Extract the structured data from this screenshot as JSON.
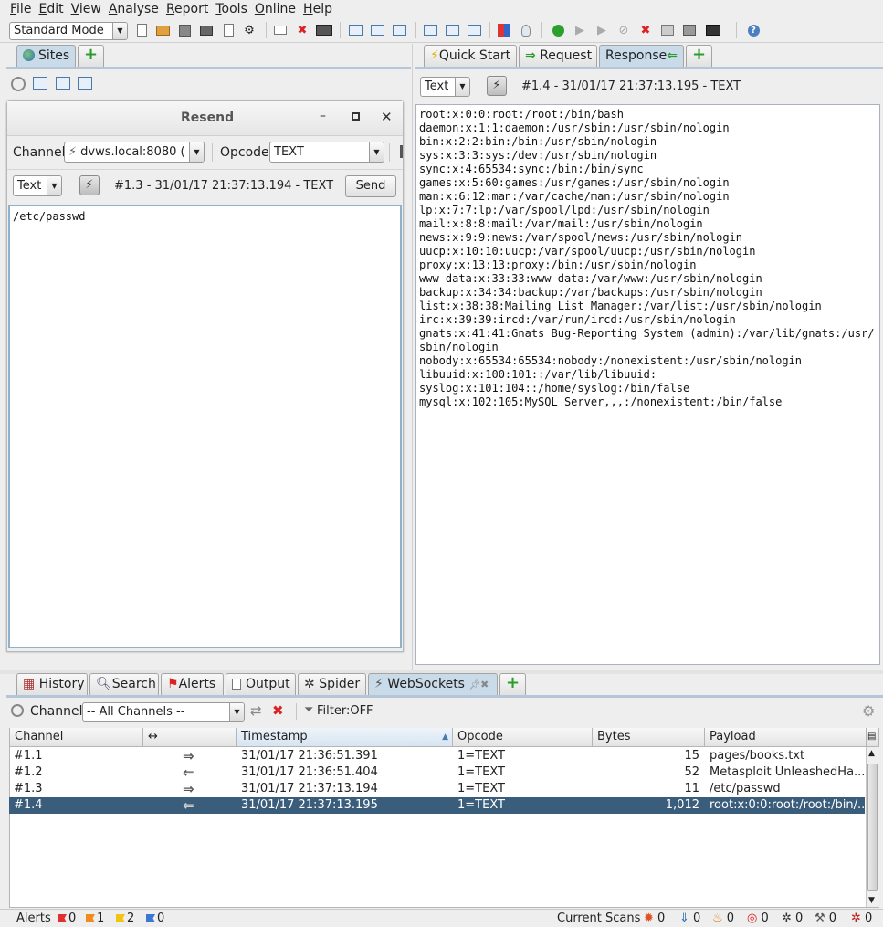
{
  "menu": {
    "items": [
      "File",
      "Edit",
      "View",
      "Analyse",
      "Report",
      "Tools",
      "Online",
      "Help"
    ],
    "underline": [
      "F",
      "E",
      "V",
      "A",
      "R",
      "T",
      "O",
      "H"
    ]
  },
  "toolbar": {
    "mode": "Standard Mode"
  },
  "sites_panel": {
    "tab_label": "Sites"
  },
  "resend": {
    "title": "Resend",
    "channel_label": "Channel:",
    "channel_value": "dvws.local:8080 (",
    "opcode_label": "Opcode:",
    "opcode_value": "TEXT",
    "format_value": "Text",
    "message_info": "#1.3 - 31/01/17 21:37:13.194 - TEXT",
    "send_label": "Send",
    "body": "/etc/passwd"
  },
  "right_tabs": [
    "Quick Start",
    "Request",
    "Response"
  ],
  "response": {
    "format_value": "Text",
    "message_info": "#1.4 - 31/01/17 21:37:13.195 - TEXT",
    "lines": [
      "root:x:0:0:root:/root:/bin/bash",
      "daemon:x:1:1:daemon:/usr/sbin:/usr/sbin/nologin",
      "bin:x:2:2:bin:/bin:/usr/sbin/nologin",
      "sys:x:3:3:sys:/dev:/usr/sbin/nologin",
      "sync:x:4:65534:sync:/bin:/bin/sync",
      "games:x:5:60:games:/usr/games:/usr/sbin/nologin",
      "man:x:6:12:man:/var/cache/man:/usr/sbin/nologin",
      "lp:x:7:7:lp:/var/spool/lpd:/usr/sbin/nologin",
      "mail:x:8:8:mail:/var/mail:/usr/sbin/nologin",
      "news:x:9:9:news:/var/spool/news:/usr/sbin/nologin",
      "uucp:x:10:10:uucp:/var/spool/uucp:/usr/sbin/nologin",
      "proxy:x:13:13:proxy:/bin:/usr/sbin/nologin",
      "www-data:x:33:33:www-data:/var/www:/usr/sbin/nologin",
      "backup:x:34:34:backup:/var/backups:/usr/sbin/nologin",
      "list:x:38:38:Mailing List Manager:/var/list:/usr/sbin/nologin",
      "irc:x:39:39:ircd:/var/run/ircd:/usr/sbin/nologin",
      "gnats:x:41:41:Gnats Bug-Reporting System (admin):/var/lib/gnats:/usr/",
      "sbin/nologin",
      "nobody:x:65534:65534:nobody:/nonexistent:/usr/sbin/nologin",
      "libuuid:x:100:101::/var/lib/libuuid:",
      "syslog:x:101:104::/home/syslog:/bin/false",
      "mysql:x:102:105:MySQL Server,,,:/nonexistent:/bin/false"
    ]
  },
  "bottom_tabs": [
    "History",
    "Search",
    "Alerts",
    "Output",
    "Spider",
    "WebSockets"
  ],
  "ws_toolbar": {
    "channel_label": "Channel:",
    "channel_value": "-- All Channels --",
    "filter": "Filter:OFF"
  },
  "table": {
    "headers": [
      "Channel",
      "↔",
      "Timestamp",
      "Opcode",
      "Bytes",
      "Payload"
    ],
    "rows": [
      {
        "channel": "#1.1",
        "dir": "out",
        "timestamp": "31/01/17 21:36:51.391",
        "opcode": "1=TEXT",
        "bytes": "15",
        "payload": "pages/books.txt"
      },
      {
        "channel": "#1.2",
        "dir": "in",
        "timestamp": "31/01/17 21:36:51.404",
        "opcode": "1=TEXT",
        "bytes": "52",
        "payload": "Metasploit UnleashedHa..."
      },
      {
        "channel": "#1.3",
        "dir": "out",
        "timestamp": "31/01/17 21:37:13.194",
        "opcode": "1=TEXT",
        "bytes": "11",
        "payload": "/etc/passwd"
      },
      {
        "channel": "#1.4",
        "dir": "in",
        "timestamp": "31/01/17 21:37:13.195",
        "opcode": "1=TEXT",
        "bytes": "1,012",
        "payload": "root:x:0:0:root:/root:/bin/..."
      }
    ],
    "selected_index": 3
  },
  "status": {
    "alerts_label": "Alerts",
    "alerts_high": "0",
    "alerts_medium": "1",
    "alerts_low": "2",
    "alerts_info": "0",
    "scans_label": "Current Scans",
    "scan_counts": [
      "0",
      "0",
      "0",
      "0",
      "0",
      "0",
      "0"
    ]
  },
  "colors": {
    "selection": "#3b5d7c",
    "tab_selected": "#c9dbe9",
    "add_green": "#2e9b2e"
  }
}
